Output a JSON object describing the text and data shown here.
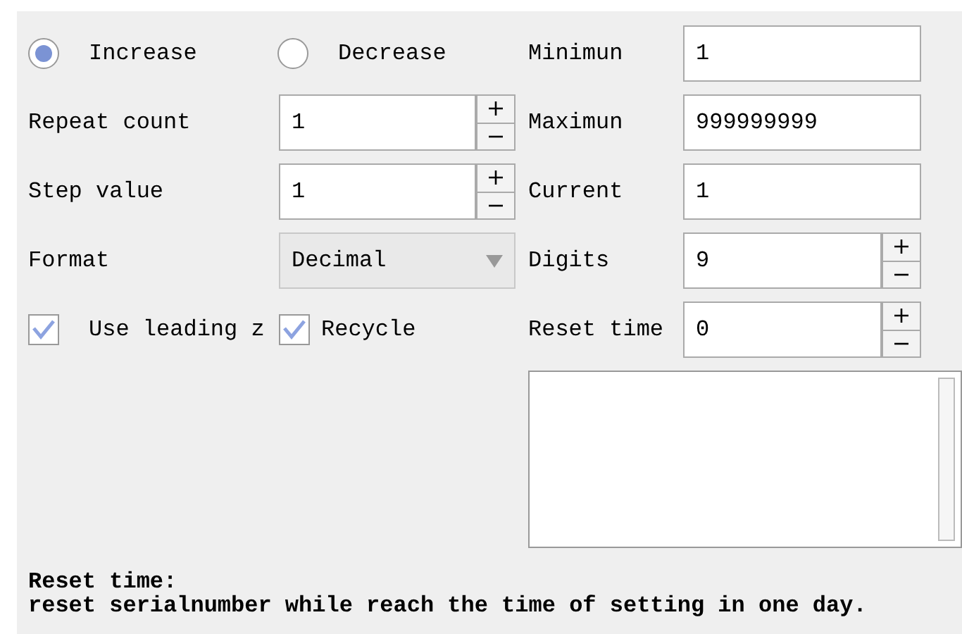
{
  "direction": [
    {
      "label": "Increase",
      "selected": true
    },
    {
      "label": "Decrease",
      "selected": false
    }
  ],
  "left_fields": [
    {
      "kind": "spin",
      "label": "Repeat count",
      "value": "1"
    },
    {
      "kind": "spin",
      "label": "Step value",
      "value": "1"
    },
    {
      "kind": "select",
      "label": "Format",
      "value": "Decimal"
    }
  ],
  "checkboxes": [
    {
      "label": "Use leading z",
      "checked": true
    },
    {
      "label": "Recycle",
      "checked": true
    }
  ],
  "right_fields": [
    {
      "kind": "text",
      "label": "Minimun",
      "value": "1"
    },
    {
      "kind": "text",
      "label": "Maximun",
      "value": "999999999"
    },
    {
      "kind": "text",
      "label": "Current",
      "value": "1"
    },
    {
      "kind": "spin",
      "label": "Digits",
      "value": "9"
    },
    {
      "kind": "spin",
      "label": "Reset time",
      "value": "0"
    }
  ],
  "help": {
    "title": "Reset time:",
    "text": "reset serialnumber while reach the time of setting in one day."
  }
}
